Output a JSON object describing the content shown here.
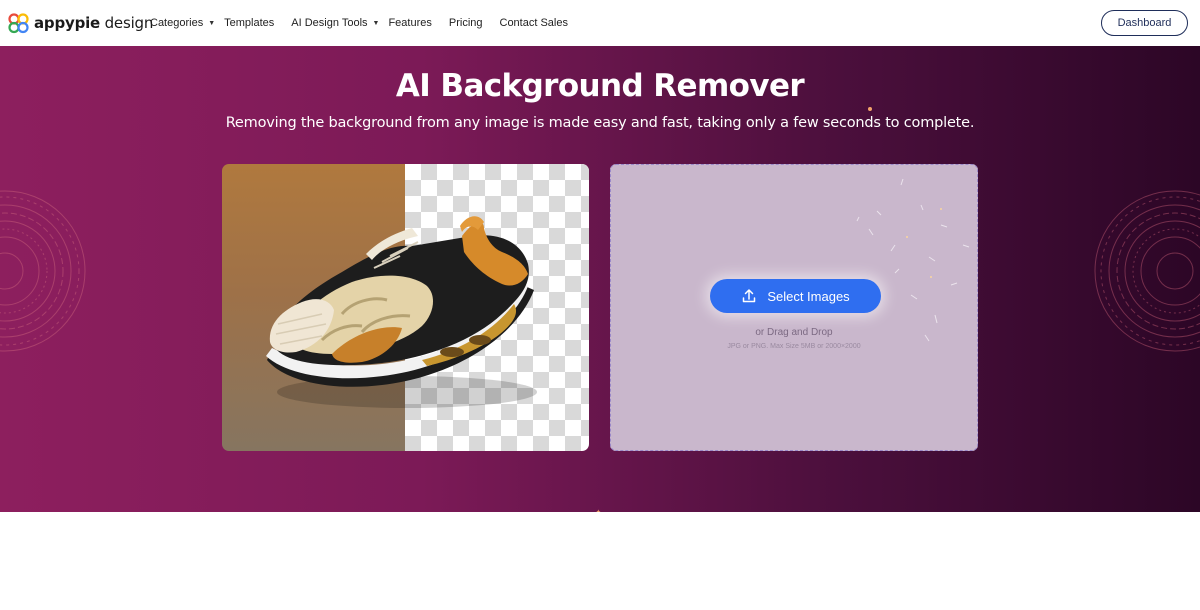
{
  "brand": {
    "name_bold": "appypie",
    "name_rest": " design"
  },
  "nav": {
    "items": [
      {
        "label": "Categories",
        "has_dropdown": true
      },
      {
        "label": "Templates",
        "has_dropdown": false
      },
      {
        "label": "AI Design Tools",
        "has_dropdown": true
      },
      {
        "label": "Features",
        "has_dropdown": false
      },
      {
        "label": "Pricing",
        "has_dropdown": false
      },
      {
        "label": "Contact Sales",
        "has_dropdown": false
      }
    ],
    "dashboard_label": "Dashboard"
  },
  "hero": {
    "title": "AI Background Remover",
    "subtitle": "Removing the background from any image is made easy and fast, taking only a few seconds to complete."
  },
  "upload": {
    "button_label": "Select Images",
    "drag_text": "or Drag and Drop",
    "limits_text": "JPG or PNG. Max Size 5MB or 2000×2000"
  },
  "icons": {
    "upload": "upload-icon",
    "caret": "chevron-down-icon",
    "logo": "appypie-logo-icon"
  },
  "colors": {
    "accent": "#2f6ef0",
    "hero_start": "#8d1f5e",
    "hero_end": "#2c0626",
    "dashboard_border": "#1f2e5a"
  }
}
